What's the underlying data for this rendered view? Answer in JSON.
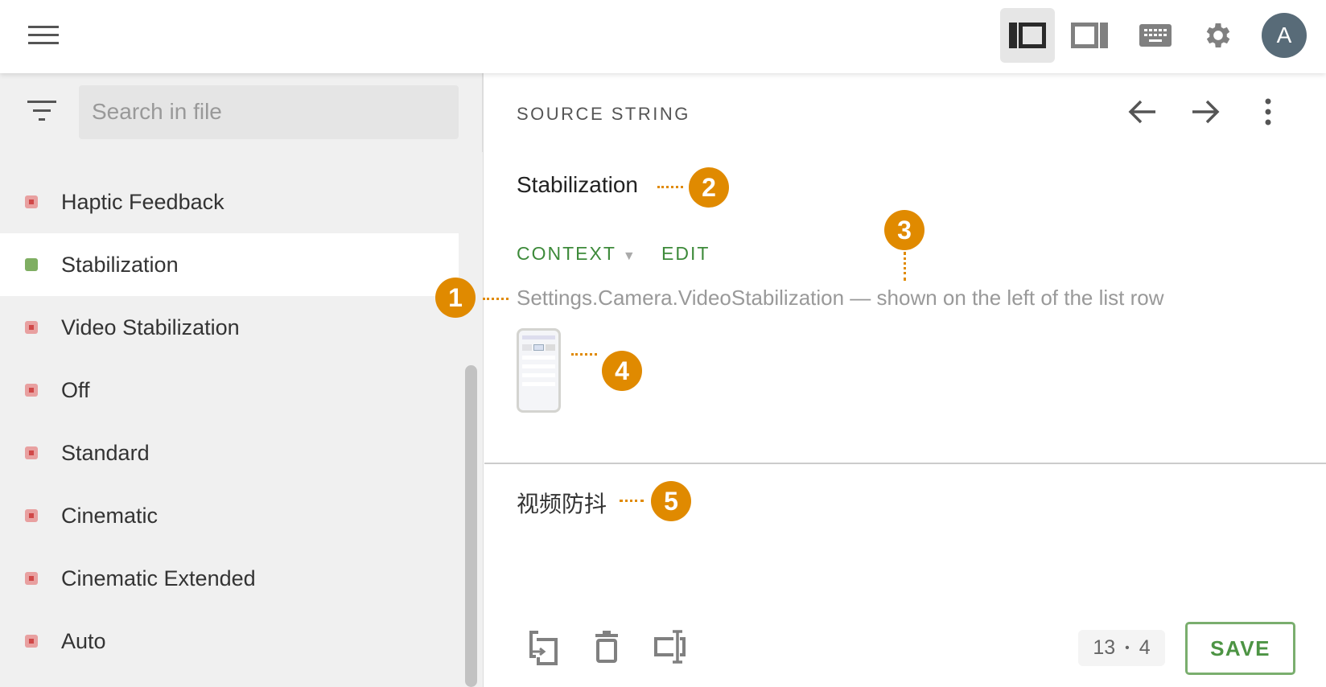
{
  "header": {
    "menu_icon": "hamburger-icon",
    "layout_icons": [
      "sidebar-left-layout-icon",
      "sidebar-right-layout-icon",
      "keyboard-icon",
      "gear-icon"
    ],
    "avatar_letter": "A"
  },
  "sidebar": {
    "search_placeholder": "Search in file",
    "items": [
      {
        "label": "Haptic Feedback",
        "status": "untranslated"
      },
      {
        "label": "Stabilization",
        "status": "translated",
        "selected": true
      },
      {
        "label": "Video Stabilization",
        "status": "untranslated"
      },
      {
        "label": "Off",
        "status": "untranslated"
      },
      {
        "label": "Standard",
        "status": "untranslated"
      },
      {
        "label": "Cinematic",
        "status": "untranslated"
      },
      {
        "label": "Cinematic Extended",
        "status": "untranslated"
      },
      {
        "label": "Auto",
        "status": "untranslated"
      }
    ]
  },
  "source": {
    "heading": "SOURCE STRING",
    "text": "Stabilization",
    "context_label": "CONTEXT",
    "edit_label": "EDIT",
    "context_text": "Settings.Camera.VideoStabilization — shown on the left of the list row"
  },
  "translation": {
    "text": "视频防抖",
    "counter_a": "13",
    "counter_sep": "•",
    "counter_b": "4",
    "save_label": "SAVE"
  },
  "callouts": [
    "1",
    "2",
    "3",
    "4",
    "5"
  ],
  "colors": {
    "accent": "#e08a00",
    "green": "#3d8a3a",
    "untranslated": "#d04848",
    "translated": "#7fae62"
  }
}
